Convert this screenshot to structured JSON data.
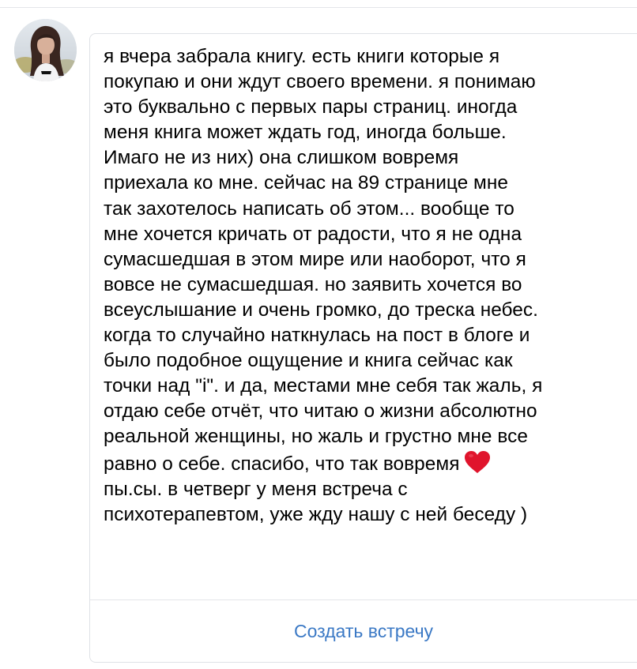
{
  "message": {
    "text": "я вчера забрала книгу. есть книги которые я\nпокупаю и они ждут своего времени. я понимаю\nэто буквально с первых пары страниц. иногда\nменя книга может ждать год, иногда больше.\nИмаго не из них) она слишком вовремя\nприехала ко мне. сейчас на 89 странице мне\nтак захотелось написать об этом... вообще то\nмне хочется кричать от радости, что я не одна\nсумасшедшая в этом мире или наоборот, что я\nвовсе не сумасшедшая. но заявить хочется во\nвсеуслышание и очень громко, до треска небес.\nкогда то случайно наткнулась на пост в блоге и\nбыло подобное ощущение и книга сейчас как\nточки над \"і\". и да, местами мне себя так жаль, я\nотдаю себе отчёт, что читаю о жизни абсолютно\nреальной женщины, но жаль и грустно мне все\nравно о себе. спасибо, что так вовремя",
    "text_after_heart": "\nпы.сы. в четверг у меня встреча с\nпсихотерапевтом, уже жду нашу с ней беседу )",
    "emoji": "heart-icon",
    "emoji_color": "#e0142c"
  },
  "actions": {
    "create_meeting_label": "Создать встречу",
    "link_color": "#3b79c5"
  }
}
